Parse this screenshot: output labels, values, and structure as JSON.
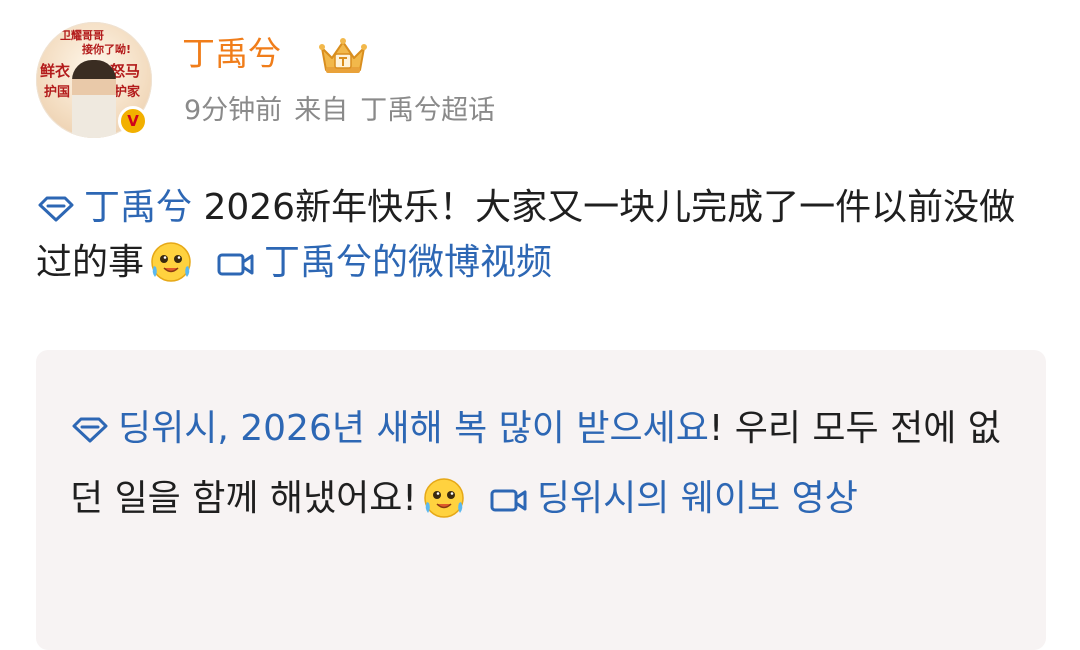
{
  "post": {
    "username": "丁禹兮",
    "time": "9分钟前",
    "source_prefix": "来自",
    "source": "丁禹兮超话",
    "avatar_text": [
      "卫耀哥哥",
      "接你了呦!",
      "鲜衣",
      "怒马",
      "护国",
      "护家"
    ],
    "verified_badge": "V",
    "text": {
      "mention": "丁禹兮",
      "body": " 2026新年快乐！大家又一块儿完成了一件以前没做过的事",
      "video_link": "丁禹兮的微博视频"
    }
  },
  "translation": {
    "mention": "딩위시, 2026년 새해 복 많이 받으세요",
    "body": "! 우리 모두 전에 없던 일을 함께 해냈어요!",
    "video_link": "딩위시의 웨이보 영상"
  },
  "icons": [
    "crown-icon",
    "diamond-icon",
    "emoji-icon",
    "video-icon"
  ],
  "colors": {
    "username": "#f07d1a",
    "link": "#2d67b4",
    "meta": "#8a8a8a",
    "translation_bg": "#f7f3f3"
  }
}
